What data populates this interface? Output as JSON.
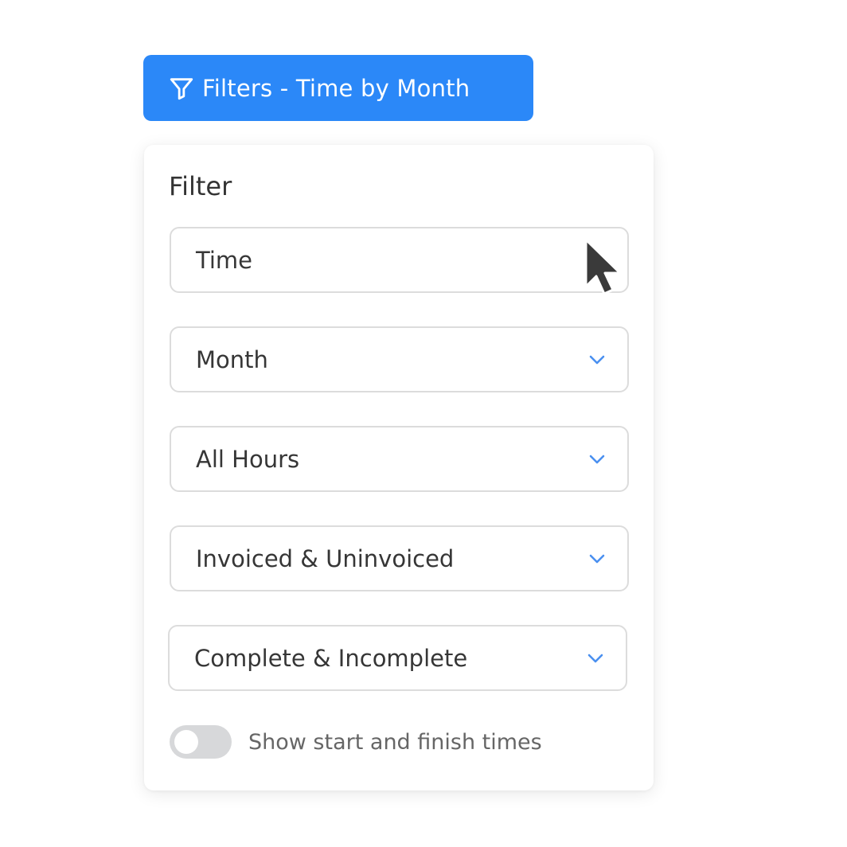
{
  "header_button": {
    "label": "Filters - Time by Month",
    "icon": "funnel-icon",
    "color": "#2b88f8"
  },
  "panel": {
    "title": "Filter",
    "fields": [
      {
        "value": "Time",
        "has_chevron": false
      },
      {
        "value": "Month",
        "has_chevron": true
      },
      {
        "value": "All Hours",
        "has_chevron": true
      },
      {
        "value": "Invoiced & Uninvoiced",
        "has_chevron": true
      },
      {
        "value": "Complete & Incomplete",
        "has_chevron": true
      }
    ],
    "toggle": {
      "label": "Show start and finish times",
      "on": false
    }
  },
  "colors": {
    "accent": "#2b88f8",
    "chevron": "#4a90f0",
    "border": "#dcdcdc",
    "toggle_off": "#d7d8da",
    "cursor": "#3a3a3a"
  }
}
